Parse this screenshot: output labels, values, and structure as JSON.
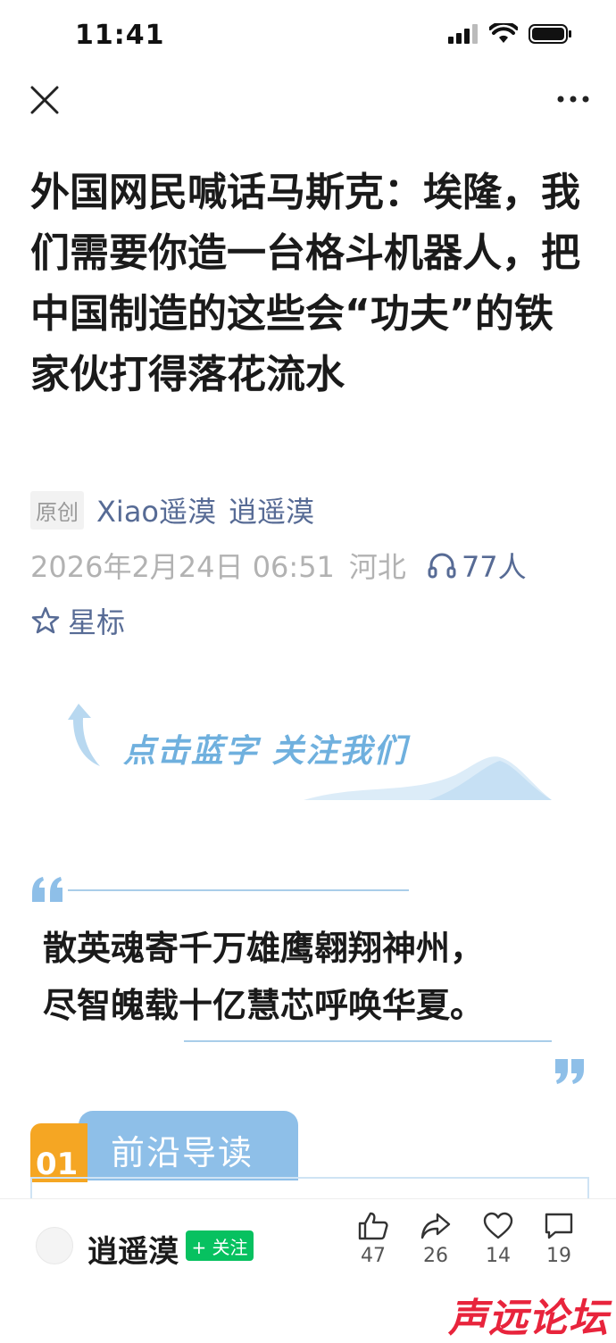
{
  "status_bar": {
    "time": "11:41"
  },
  "article": {
    "title": "外国网民喊话马斯克：埃隆，我们需要你造一台格斗机器人，把中国制造的这些会“功夫”的铁家伙打得落花流水",
    "badge": "原创",
    "author": "Xiao遥漠",
    "account": "逍遥漠",
    "date": "2026年2月24日 06:51",
    "location": "河北",
    "listeners": "77人",
    "star_label": "星标"
  },
  "follow_banner": {
    "text": "点击蓝字  关注我们"
  },
  "quote": {
    "line1": "散英魂寄千万雄鹰翱翔神州，",
    "line2": "尽智魄载十亿慧芯呼唤华夏。"
  },
  "section": {
    "number": "01",
    "title": "前沿导读"
  },
  "bottom_bar": {
    "account_name": "逍遥漠",
    "follow_label": "+ 关注",
    "likes": "47",
    "shares": "26",
    "favorites": "14",
    "comments": "19"
  },
  "watermark": "声远论坛",
  "colors": {
    "link": "#576b95",
    "accent_blue": "#8ebfe8",
    "accent_orange": "#f5a623",
    "follow_green": "#07c160",
    "watermark_red": "#e8243c"
  }
}
